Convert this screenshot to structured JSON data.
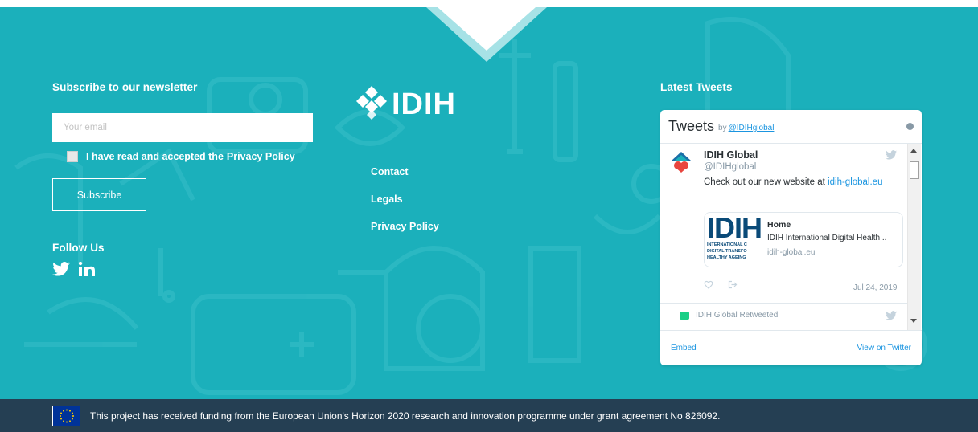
{
  "newsletter": {
    "title": "Subscribe to our newsletter",
    "email_placeholder": "Your email",
    "consent_text": "I have read and accepted the",
    "privacy_link": "Privacy Policy",
    "subscribe_label": "Subscribe"
  },
  "follow": {
    "title": "Follow Us",
    "icons": [
      "twitter-icon",
      "linkedin-icon"
    ]
  },
  "brand": {
    "logo_text": "IDIH"
  },
  "nav": {
    "items": [
      "Contact",
      "Legals",
      "Privacy Policy"
    ]
  },
  "tweets": {
    "section_title": "Latest Tweets",
    "header_title": "Tweets",
    "header_by": "by",
    "header_handle": "@IDIHglobal",
    "tweet": {
      "name": "IDIH Global",
      "handle": "@IDIHglobal",
      "text": "Check out our new website at",
      "link": "idih-global.eu",
      "date": "Jul 24, 2019",
      "card": {
        "thumb_big": "IDIH",
        "thumb_small": "INTERNATIONAL C\nDIGITAL TRANSFO\nHEALTHY AGEING",
        "title": "Home",
        "description": "IDIH International Digital Health...",
        "url": "idih-global.eu"
      }
    },
    "retweet_label": "IDIH Global Retweeted",
    "footer_embed": "Embed",
    "footer_view": "View on Twitter"
  },
  "funding": {
    "text": "This project has received funding from the European Union's Horizon 2020 research and innovation programme under grant agreement No 826092."
  },
  "colors": {
    "teal": "#1bb0bb",
    "navy": "#253f53",
    "twitter_blue": "#1b95e0"
  }
}
